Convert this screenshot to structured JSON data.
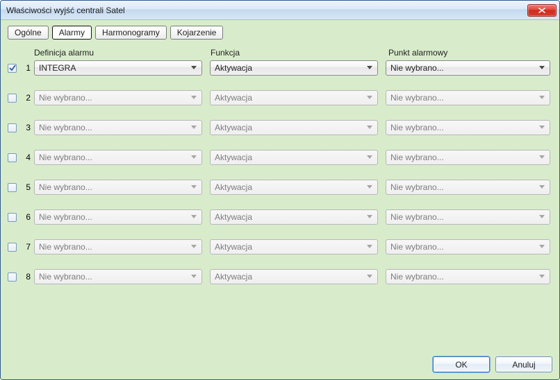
{
  "window": {
    "title": "Właściwości wyjść centrali Satel"
  },
  "tabs": {
    "general": "Ogólne",
    "alarms": "Alarmy",
    "schedules": "Harmonogramy",
    "pairing": "Kojarzenie",
    "active_index": 1
  },
  "headers": {
    "definition": "Definicja alarmu",
    "function": "Funkcja",
    "alarm_point": "Punkt alarmowy"
  },
  "rows": [
    {
      "num": "1",
      "checked": true,
      "definition": "INTEGRA",
      "function": "Aktywacja",
      "point": "Nie wybrano...",
      "enabled": true
    },
    {
      "num": "2",
      "checked": false,
      "definition": "Nie wybrano...",
      "function": "Aktywacja",
      "point": "Nie wybrano...",
      "enabled": false
    },
    {
      "num": "3",
      "checked": false,
      "definition": "Nie wybrano...",
      "function": "Aktywacja",
      "point": "Nie wybrano...",
      "enabled": false
    },
    {
      "num": "4",
      "checked": false,
      "definition": "Nie wybrano...",
      "function": "Aktywacja",
      "point": "Nie wybrano...",
      "enabled": false
    },
    {
      "num": "5",
      "checked": false,
      "definition": "Nie wybrano...",
      "function": "Aktywacja",
      "point": "Nie wybrano...",
      "enabled": false
    },
    {
      "num": "6",
      "checked": false,
      "definition": "Nie wybrano...",
      "function": "Aktywacja",
      "point": "Nie wybrano...",
      "enabled": false
    },
    {
      "num": "7",
      "checked": false,
      "definition": "Nie wybrano...",
      "function": "Aktywacja",
      "point": "Nie wybrano...",
      "enabled": false
    },
    {
      "num": "8",
      "checked": false,
      "definition": "Nie wybrano...",
      "function": "Aktywacja",
      "point": "Nie wybrano...",
      "enabled": false
    }
  ],
  "buttons": {
    "ok": "OK",
    "cancel": "Anuluj"
  }
}
